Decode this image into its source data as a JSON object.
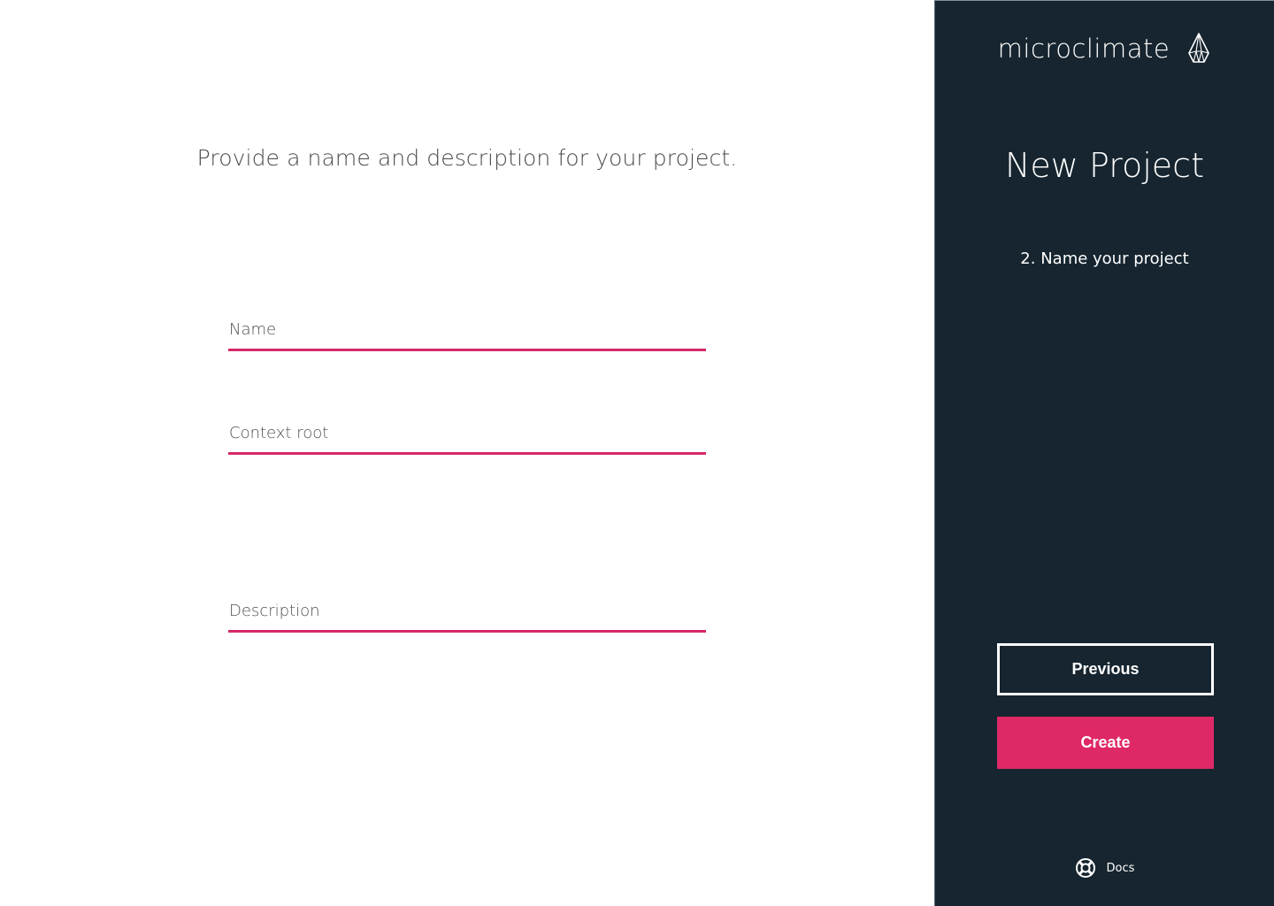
{
  "main": {
    "prompt": "Provide a name and description for your project.",
    "fields": {
      "name": {
        "label": "Name",
        "value": ""
      },
      "context_root": {
        "label": "Context root",
        "value": ""
      },
      "description": {
        "label": "Description",
        "value": ""
      }
    }
  },
  "sidebar": {
    "brand": "microclimate",
    "brand_icon": "crystal-drop-icon",
    "title": "New Project",
    "step": "2. Name your project",
    "buttons": {
      "previous": "Previous",
      "create": "Create"
    },
    "docs": {
      "label": "Docs",
      "icon": "lifebuoy-icon"
    }
  },
  "colors": {
    "accent": "#df2866",
    "sidebar_bg": "#16252f",
    "text_dark": "#4a4a4a",
    "text_light": "#ffffff"
  }
}
